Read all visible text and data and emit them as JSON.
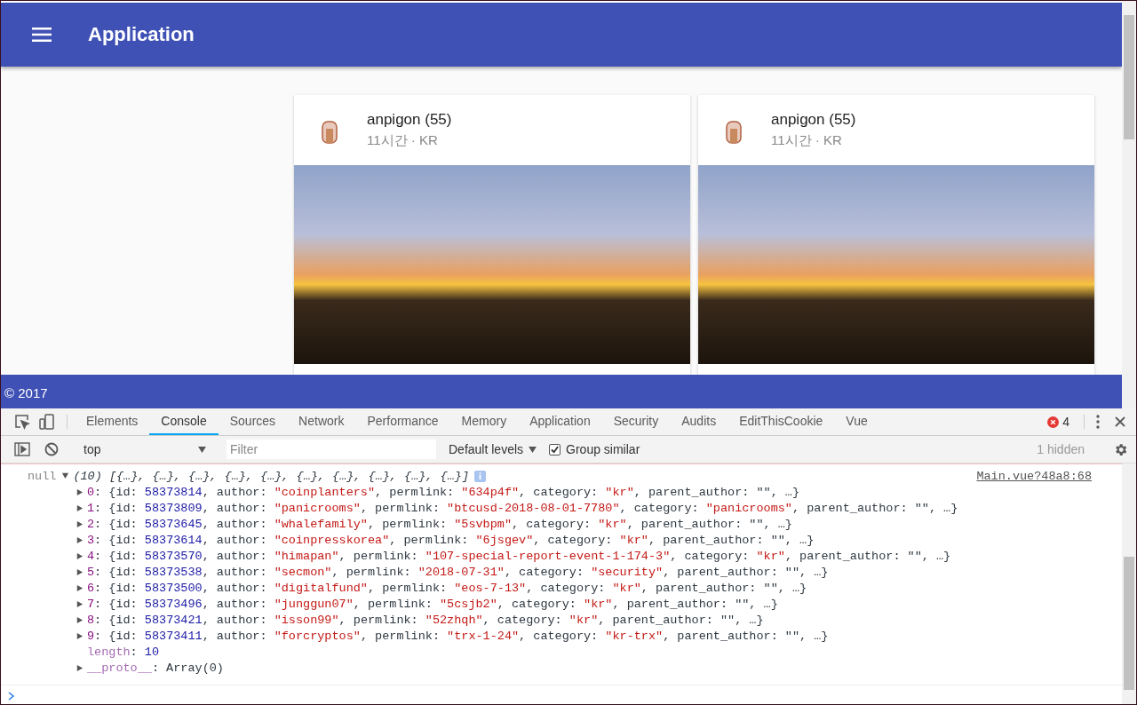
{
  "app_bar": {
    "title": "Application"
  },
  "cards": [
    {
      "author": "anpigon (55)",
      "meta": "11시간 · KR"
    },
    {
      "author": "anpigon (55)",
      "meta": "11시간 · KR"
    }
  ],
  "footer": {
    "text": "© 2017"
  },
  "devtools": {
    "tabs": [
      {
        "label": "Elements",
        "selected": false
      },
      {
        "label": "Console",
        "selected": true
      },
      {
        "label": "Sources",
        "selected": false
      },
      {
        "label": "Network",
        "selected": false
      },
      {
        "label": "Performance",
        "selected": false
      },
      {
        "label": "Memory",
        "selected": false
      },
      {
        "label": "Application",
        "selected": false
      },
      {
        "label": "Security",
        "selected": false
      },
      {
        "label": "Audits",
        "selected": false
      },
      {
        "label": "EditThisCookie",
        "selected": false
      },
      {
        "label": "Vue",
        "selected": false
      }
    ],
    "error_count": "4",
    "toolbar": {
      "context": "top",
      "filter_placeholder": "Filter",
      "levels": "Default levels",
      "group_similar": {
        "label": "Group similar",
        "checked": true
      },
      "hidden": "1 hidden"
    },
    "console": {
      "source": "Main.vue?48a8:68",
      "summary": {
        "expanded": true,
        "tokens": [
          {
            "text": "null",
            "kind": "muted"
          },
          {
            "text": "(10) [{…}, {…}, {…}, {…}, {…}, {…}, {…}, {…}, {…}, {…}]",
            "kind": "italic"
          }
        ]
      },
      "entries": [
        {
          "expanded": false,
          "tokens": [
            {
              "text": "0",
              "kind": "index"
            },
            {
              "text": ": {id: ",
              "kind": "plain"
            },
            {
              "text": "58373814",
              "kind": "number"
            },
            {
              "text": ", author: ",
              "kind": "plain"
            },
            {
              "text": "\"coinplanters\"",
              "kind": "string"
            },
            {
              "text": ", permlink: ",
              "kind": "plain"
            },
            {
              "text": "\"634p4f\"",
              "kind": "string"
            },
            {
              "text": ", category: ",
              "kind": "plain"
            },
            {
              "text": "\"kr\"",
              "kind": "string"
            },
            {
              "text": ", parent_author: \"\", …}",
              "kind": "plain"
            }
          ]
        },
        {
          "expanded": false,
          "tokens": [
            {
              "text": "1",
              "kind": "index"
            },
            {
              "text": ": {id: ",
              "kind": "plain"
            },
            {
              "text": "58373809",
              "kind": "number"
            },
            {
              "text": ", author: ",
              "kind": "plain"
            },
            {
              "text": "\"panicrooms\"",
              "kind": "string"
            },
            {
              "text": ", permlink: ",
              "kind": "plain"
            },
            {
              "text": "\"btcusd-2018-08-01-7780\"",
              "kind": "string"
            },
            {
              "text": ", category: ",
              "kind": "plain"
            },
            {
              "text": "\"panicrooms\"",
              "kind": "string"
            },
            {
              "text": ", parent_author: \"\", …}",
              "kind": "plain"
            }
          ]
        },
        {
          "expanded": false,
          "tokens": [
            {
              "text": "2",
              "kind": "index"
            },
            {
              "text": ": {id: ",
              "kind": "plain"
            },
            {
              "text": "58373645",
              "kind": "number"
            },
            {
              "text": ", author: ",
              "kind": "plain"
            },
            {
              "text": "\"whalefamily\"",
              "kind": "string"
            },
            {
              "text": ", permlink: ",
              "kind": "plain"
            },
            {
              "text": "\"5svbpm\"",
              "kind": "string"
            },
            {
              "text": ", category: ",
              "kind": "plain"
            },
            {
              "text": "\"kr\"",
              "kind": "string"
            },
            {
              "text": ", parent_author: \"\", …}",
              "kind": "plain"
            }
          ]
        },
        {
          "expanded": false,
          "tokens": [
            {
              "text": "3",
              "kind": "index"
            },
            {
              "text": ": {id: ",
              "kind": "plain"
            },
            {
              "text": "58373614",
              "kind": "number"
            },
            {
              "text": ", author: ",
              "kind": "plain"
            },
            {
              "text": "\"coinpresskorea\"",
              "kind": "string"
            },
            {
              "text": ", permlink: ",
              "kind": "plain"
            },
            {
              "text": "\"6jsgev\"",
              "kind": "string"
            },
            {
              "text": ", category: ",
              "kind": "plain"
            },
            {
              "text": "\"kr\"",
              "kind": "string"
            },
            {
              "text": ", parent_author: \"\", …}",
              "kind": "plain"
            }
          ]
        },
        {
          "expanded": false,
          "tokens": [
            {
              "text": "4",
              "kind": "index"
            },
            {
              "text": ": {id: ",
              "kind": "plain"
            },
            {
              "text": "58373570",
              "kind": "number"
            },
            {
              "text": ", author: ",
              "kind": "plain"
            },
            {
              "text": "\"himapan\"",
              "kind": "string"
            },
            {
              "text": ", permlink: ",
              "kind": "plain"
            },
            {
              "text": "\"107-special-report-event-1-174-3\"",
              "kind": "string"
            },
            {
              "text": ", category: ",
              "kind": "plain"
            },
            {
              "text": "\"kr\"",
              "kind": "string"
            },
            {
              "text": ", parent_author: \"\", …}",
              "kind": "plain"
            }
          ]
        },
        {
          "expanded": false,
          "tokens": [
            {
              "text": "5",
              "kind": "index"
            },
            {
              "text": ": {id: ",
              "kind": "plain"
            },
            {
              "text": "58373538",
              "kind": "number"
            },
            {
              "text": ", author: ",
              "kind": "plain"
            },
            {
              "text": "\"secmon\"",
              "kind": "string"
            },
            {
              "text": ", permlink: ",
              "kind": "plain"
            },
            {
              "text": "\"2018-07-31\"",
              "kind": "string"
            },
            {
              "text": ", category: ",
              "kind": "plain"
            },
            {
              "text": "\"security\"",
              "kind": "string"
            },
            {
              "text": ", parent_author: \"\", …}",
              "kind": "plain"
            }
          ]
        },
        {
          "expanded": false,
          "tokens": [
            {
              "text": "6",
              "kind": "index"
            },
            {
              "text": ": {id: ",
              "kind": "plain"
            },
            {
              "text": "58373500",
              "kind": "number"
            },
            {
              "text": ", author: ",
              "kind": "plain"
            },
            {
              "text": "\"digitalfund\"",
              "kind": "string"
            },
            {
              "text": ", permlink: ",
              "kind": "plain"
            },
            {
              "text": "\"eos-7-13\"",
              "kind": "string"
            },
            {
              "text": ", category: ",
              "kind": "plain"
            },
            {
              "text": "\"kr\"",
              "kind": "string"
            },
            {
              "text": ", parent_author: \"\", …}",
              "kind": "plain"
            }
          ]
        },
        {
          "expanded": false,
          "tokens": [
            {
              "text": "7",
              "kind": "index"
            },
            {
              "text": ": {id: ",
              "kind": "plain"
            },
            {
              "text": "58373496",
              "kind": "number"
            },
            {
              "text": ", author: ",
              "kind": "plain"
            },
            {
              "text": "\"junggun07\"",
              "kind": "string"
            },
            {
              "text": ", permlink: ",
              "kind": "plain"
            },
            {
              "text": "\"5csjb2\"",
              "kind": "string"
            },
            {
              "text": ", category: ",
              "kind": "plain"
            },
            {
              "text": "\"kr\"",
              "kind": "string"
            },
            {
              "text": ", parent_author: \"\", …}",
              "kind": "plain"
            }
          ]
        },
        {
          "expanded": false,
          "tokens": [
            {
              "text": "8",
              "kind": "index"
            },
            {
              "text": ": {id: ",
              "kind": "plain"
            },
            {
              "text": "58373421",
              "kind": "number"
            },
            {
              "text": ", author: ",
              "kind": "plain"
            },
            {
              "text": "\"isson99\"",
              "kind": "string"
            },
            {
              "text": ", permlink: ",
              "kind": "plain"
            },
            {
              "text": "\"52zhqh\"",
              "kind": "string"
            },
            {
              "text": ", category: ",
              "kind": "plain"
            },
            {
              "text": "\"kr\"",
              "kind": "string"
            },
            {
              "text": ", parent_author: \"\", …}",
              "kind": "plain"
            }
          ]
        },
        {
          "expanded": false,
          "tokens": [
            {
              "text": "9",
              "kind": "index"
            },
            {
              "text": ": {id: ",
              "kind": "plain"
            },
            {
              "text": "58373411",
              "kind": "number"
            },
            {
              "text": ", author: ",
              "kind": "plain"
            },
            {
              "text": "\"forcryptos\"",
              "kind": "string"
            },
            {
              "text": ", permlink: ",
              "kind": "plain"
            },
            {
              "text": "\"trx-1-24\"",
              "kind": "string"
            },
            {
              "text": ", category: ",
              "kind": "plain"
            },
            {
              "text": "\"kr-trx\"",
              "kind": "string"
            },
            {
              "text": ", parent_author: \"\", …}",
              "kind": "plain"
            }
          ]
        }
      ],
      "length_line": {
        "tokens": [
          {
            "text": "length",
            "kind": "meta"
          },
          {
            "text": ": ",
            "kind": "plain"
          },
          {
            "text": "10",
            "kind": "number"
          }
        ]
      },
      "proto_line": {
        "expanded": false,
        "tokens": [
          {
            "text": "__proto__",
            "kind": "meta"
          },
          {
            "text": ": Array(0)",
            "kind": "plain"
          }
        ]
      }
    }
  }
}
